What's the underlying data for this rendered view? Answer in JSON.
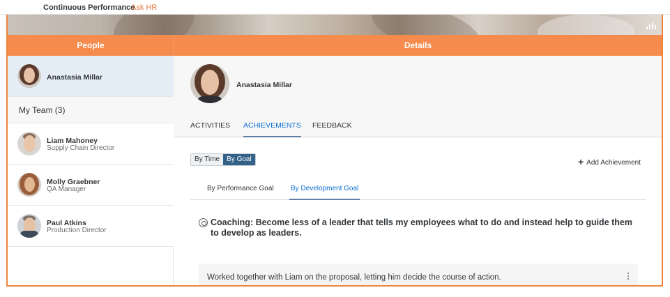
{
  "topbar": {
    "app_title": "Continuous Performance",
    "ask_hr": "Ask HR"
  },
  "panels": {
    "people_title": "People",
    "details_title": "Details"
  },
  "people": {
    "self": {
      "name": "Anastasia Millar"
    },
    "team_header": "My Team (3)",
    "members": [
      {
        "name": "Liam Mahoney",
        "role": "Supply Chain Director"
      },
      {
        "name": "Molly Graebner",
        "role": "QA Manager"
      },
      {
        "name": "Paul Atkins",
        "role": "Production Director"
      }
    ]
  },
  "details": {
    "profile_name": "Anastasia Millar",
    "tabs": [
      "ACTIVITIES",
      "ACHIEVEMENTS",
      "FEEDBACK"
    ],
    "active_tab": "ACHIEVEMENTS",
    "view_toggle": [
      "By Time",
      "By Goal"
    ],
    "active_view": "By Goal",
    "add_achievement": "Add Achievement",
    "goal_tabs": [
      "By Performance Goal",
      "By Development Goal"
    ],
    "active_goal_tab": "By Development Goal",
    "goal_title": "Coaching: Become less of a leader that tells my employees what to do and instead help to guide them to develop as leaders.",
    "achievement_text": "Worked together with Liam on the proposal, letting him decide the course of action."
  },
  "colors": {
    "header_orange": "#f58b4c",
    "accent_blue": "#0a6ed1",
    "toggle_active": "#346187",
    "link_orange": "#e9773b"
  },
  "icons": [
    "chart-icon",
    "plus-icon",
    "target-icon",
    "more-vertical-icon"
  ]
}
